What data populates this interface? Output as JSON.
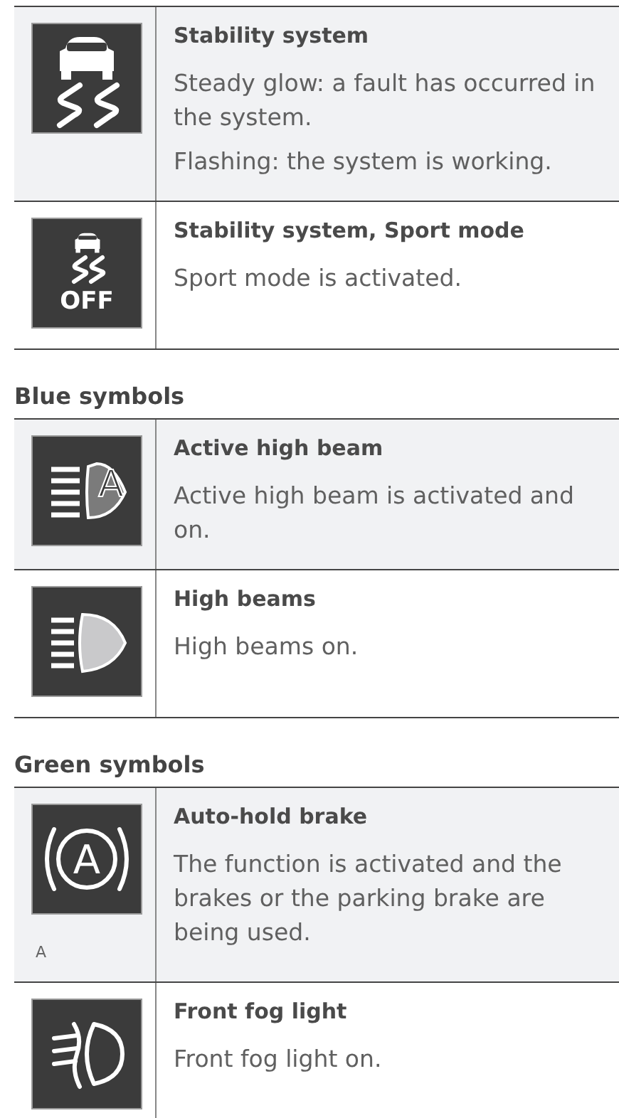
{
  "sections": [
    {
      "rows": [
        {
          "kind": "skid",
          "title": "Stability system",
          "paragraphs": [
            "Steady glow: a fault has occurred in the system.",
            "Flashing: the system is working."
          ]
        },
        {
          "kind": "skid_off",
          "icon_text": "OFF",
          "title": "Stability system, Sport mode",
          "paragraphs": [
            "Sport mode is activated."
          ]
        }
      ]
    },
    {
      "heading": "Blue symbols",
      "rows": [
        {
          "kind": "auto_high_beam",
          "icon_text": "A",
          "title": "Active high beam",
          "paragraphs": [
            "Active high beam is activated and on."
          ]
        },
        {
          "kind": "high_beam",
          "title": "High beams",
          "paragraphs": [
            "High beams on."
          ]
        }
      ]
    },
    {
      "heading": "Green symbols",
      "rows": [
        {
          "kind": "auto_hold",
          "icon_text": "A",
          "caption": "A",
          "title": "Auto-hold brake",
          "paragraphs": [
            "The function is activated and the brakes or the parking brake are being used."
          ]
        },
        {
          "kind": "front_fog",
          "title": "Front fog light",
          "paragraphs": [
            "Front fog light on."
          ]
        }
      ]
    }
  ]
}
